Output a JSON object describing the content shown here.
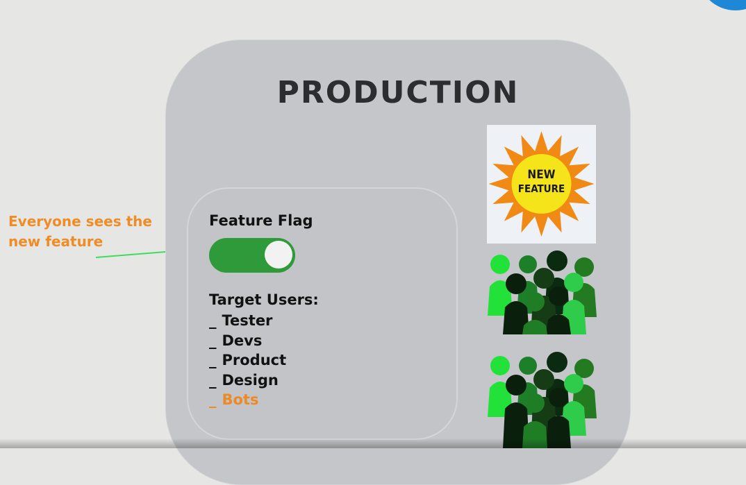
{
  "diagram": {
    "title": "PRODUCTION",
    "annotation": "Everyone sees the new feature",
    "feature_flag": {
      "label": "Feature Flag",
      "state": "on"
    },
    "target_users": {
      "label": "Target Users:",
      "items": [
        {
          "dash": "_",
          "name": "Tester"
        },
        {
          "dash": "_",
          "name": "Devs"
        },
        {
          "dash": "_",
          "name": "Product"
        },
        {
          "dash": "_",
          "name": "Design"
        },
        {
          "dash": "_",
          "name": "Bots",
          "highlight": true
        }
      ]
    },
    "badge": {
      "line1": "NEW",
      "line2": "FEATURE"
    },
    "colors": {
      "accent_orange": "#ef8c26",
      "toggle_green": "#2f9a3a",
      "arrow_green": "#3ddc5a",
      "sun_outer": "#f08a14",
      "sun_inner": "#f5e41a"
    },
    "icons": [
      "sun-icon",
      "people-group-icon"
    ]
  }
}
